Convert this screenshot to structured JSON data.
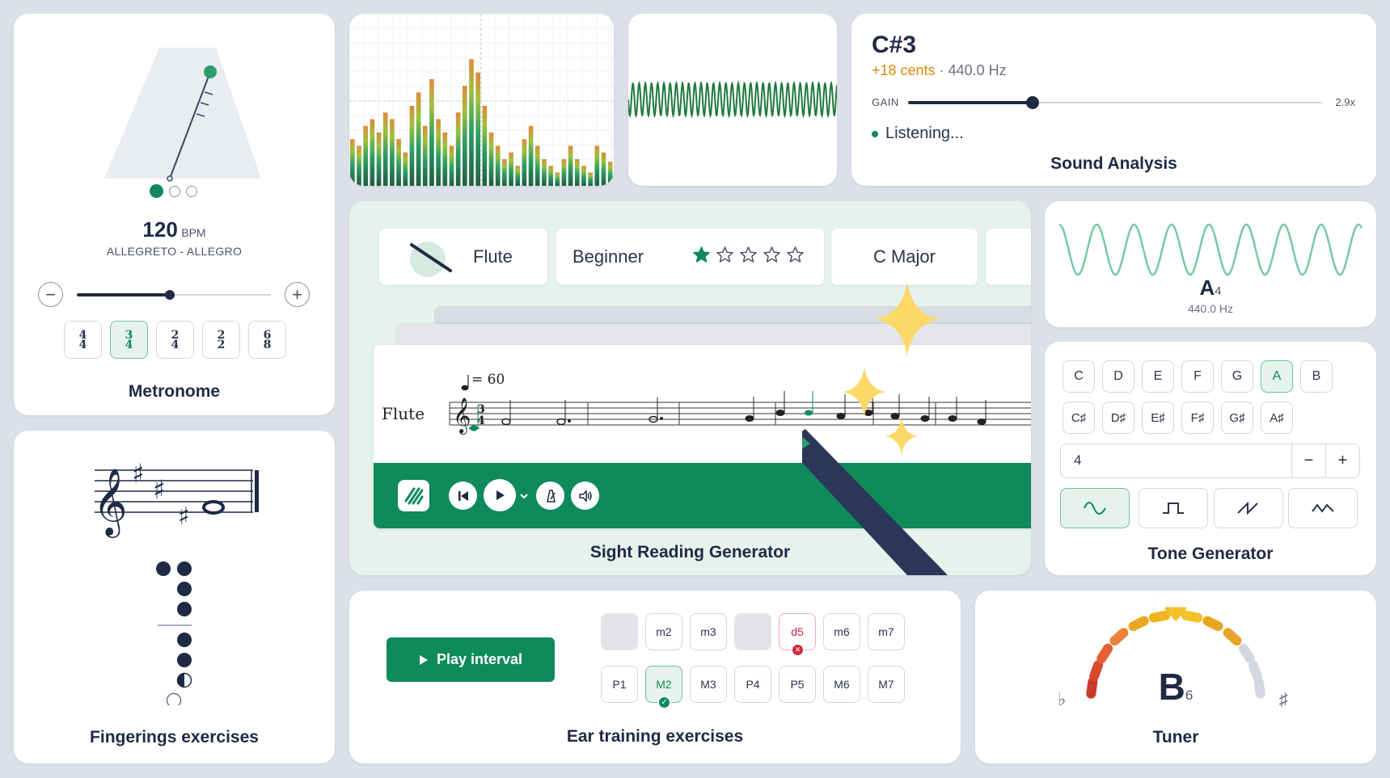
{
  "metronome": {
    "bpm": "120",
    "bpm_unit": "BPM",
    "tempo_name": "ALLEGRETO - ALLEGRO",
    "time_signatures": [
      {
        "top": "4",
        "bottom": "4",
        "selected": false
      },
      {
        "top": "3",
        "bottom": "4",
        "selected": true
      },
      {
        "top": "2",
        "bottom": "4",
        "selected": false
      },
      {
        "top": "2",
        "bottom": "2",
        "selected": false
      },
      {
        "top": "6",
        "bottom": "8",
        "selected": false
      }
    ],
    "slider_value": 0.48,
    "title": "Metronome"
  },
  "spectrum": {
    "bars": [
      0.35,
      0.3,
      0.45,
      0.5,
      0.4,
      0.55,
      0.5,
      0.35,
      0.25,
      0.6,
      0.7,
      0.45,
      0.8,
      0.5,
      0.4,
      0.3,
      0.55,
      0.75,
      0.95,
      0.85,
      0.6,
      0.4,
      0.3,
      0.2,
      0.25,
      0.15,
      0.35,
      0.45,
      0.3,
      0.2,
      0.15,
      0.1,
      0.2,
      0.3,
      0.2,
      0.15,
      0.1,
      0.3,
      0.25,
      0.18
    ]
  },
  "sound_analysis": {
    "note": "C#3",
    "cents": "+18 cents",
    "frequency": "· 440.0 Hz",
    "gain_label": "GAIN",
    "gain_value": "2.9x",
    "gain_level": 0.3,
    "status": "Listening...",
    "title": "Sound Analysis"
  },
  "sight_reading": {
    "instrument": "Flute",
    "level": "Beginner",
    "stars_filled": 1,
    "stars_total": 5,
    "key": "C Major",
    "tempo_marking": "= 60",
    "staff_instrument": "Flute",
    "title": "Sight Reading Generator"
  },
  "tone_display": {
    "note": "A",
    "octave": "4",
    "frequency": "440.0 Hz"
  },
  "tone_generator": {
    "natural_notes": [
      "C",
      "D",
      "E",
      "F",
      "G",
      "A",
      "B"
    ],
    "sharp_notes": [
      "C♯",
      "D♯",
      "E♯",
      "F♯",
      "G♯",
      "A♯"
    ],
    "selected_note": "A",
    "octave_value": "4",
    "minus": "−",
    "plus": "+",
    "waveforms": [
      "sine-icon",
      "square-icon",
      "sawtooth-icon",
      "triangle-icon"
    ],
    "title": "Tone Generator"
  },
  "fingerings": {
    "title": "Fingerings exercises"
  },
  "ear_training": {
    "play_label": "Play interval",
    "top_row": [
      "",
      "m2",
      "m3",
      "",
      "d5",
      "m6",
      "m7"
    ],
    "bottom_row": [
      "P1",
      "M2",
      "M3",
      "P4",
      "P5",
      "M6",
      "M7"
    ],
    "correct": "M2",
    "wrong": "d5",
    "title": "Ear training exercises"
  },
  "tuner": {
    "note": "B",
    "octave": "6",
    "flat": "♭",
    "sharp": "♯",
    "title": "Tuner"
  },
  "colors": {
    "accent": "#0e8a5c",
    "dark": "#1f2a44",
    "orange": "#d98a0b",
    "red": "#d3263d"
  }
}
